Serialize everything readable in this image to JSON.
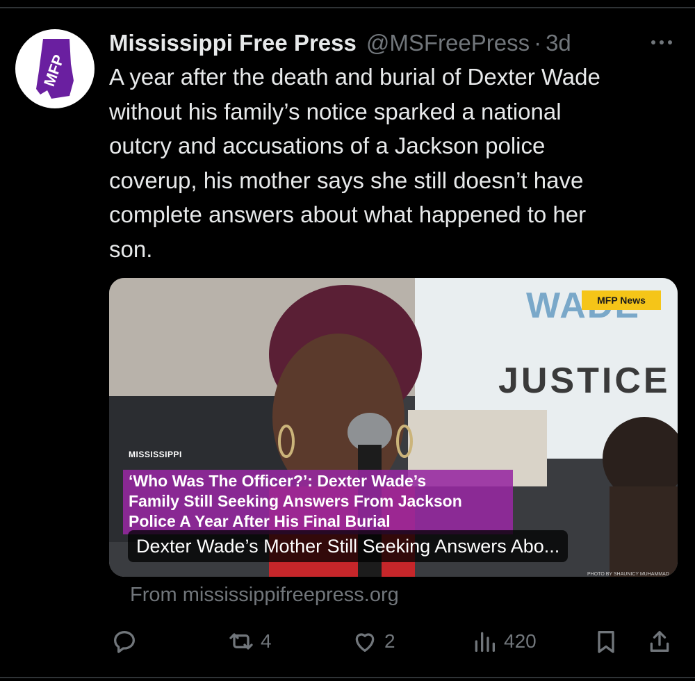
{
  "post": {
    "author_name": "Mississippi Free Press",
    "handle": "@MSFreePress",
    "separator": "·",
    "time": "3d",
    "avatar_text": "MFP",
    "text_lines": [
      "A year after the death and burial of Dexter Wade",
      "without his family’s notice sparked a national",
      "outcry and accusations of a Jackson police",
      "coverup, his mother says she still doesn’t have",
      "complete answers about what happened to her",
      "son."
    ]
  },
  "card": {
    "badge": "MFP News",
    "sign_top": "WADE",
    "sign_bottom": "JUSTICE",
    "brand_small": "MISSISSIPPI",
    "headline_lines": [
      "‘Who Was The Officer?’: Dexter Wade’s",
      "Family Still Seeking Answers From Jackson",
      "Police A Year After His Final Burial"
    ],
    "caption": "Dexter Wade’s Mother Still Seeking Answers Abo...",
    "photo_credit": "PHOTO BY SHAUNICY MUHAMMAD",
    "source": "From mississippifreepress.org"
  },
  "actions": {
    "reply_icon": "reply-icon",
    "repost_icon": "repost-icon",
    "repost_count": "4",
    "like_icon": "heart-icon",
    "like_count": "2",
    "views_icon": "views-icon",
    "views_count": "420",
    "bookmark_icon": "bookmark-icon",
    "share_icon": "share-icon"
  },
  "colors": {
    "background": "#000000",
    "text": "#e7e9ea",
    "muted": "#71767b",
    "brand_purple": "#6a1fa0",
    "headline_bg": "#9628a0",
    "badge": "#f5c518"
  }
}
